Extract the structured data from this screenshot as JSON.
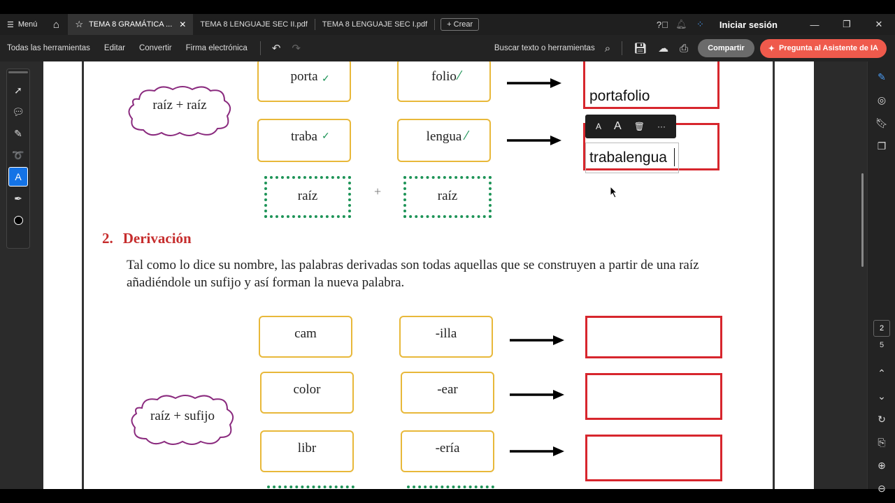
{
  "menu": {
    "label": "Menú"
  },
  "tabs": [
    {
      "label": "TEMA 8 GRAMÁTICA ...",
      "active": true
    },
    {
      "label": "TEMA 8 LENGUAJE SEC II.pdf"
    },
    {
      "label": "TEMA 8 LENGUAJE SEC I.pdf"
    }
  ],
  "create_label": "Crear",
  "signin": "Iniciar sesión",
  "toolbar": {
    "all_tools": "Todas las herramientas",
    "edit": "Editar",
    "convert": "Convertir",
    "esign": "Firma electrónica",
    "search": "Buscar texto o herramientas",
    "share": "Compartir",
    "ai": "Pregunta al Asistente de IA"
  },
  "doc": {
    "composition": {
      "cloud": "raíz + raíz",
      "rows": [
        {
          "a": "porta",
          "b": "folio",
          "answer": "portafolio"
        },
        {
          "a": "traba",
          "b": "lengua",
          "answer": "trabalengua"
        }
      ],
      "blank_a": "raíz",
      "blank_b": "raíz",
      "plus": "+"
    },
    "section": {
      "number": "2.",
      "title": "Derivación"
    },
    "paragraph": "Tal como lo dice su nombre, las palabras derivadas son todas aquellas que se construyen a partir de una raíz añadiéndole un sufijo y así forman la nueva palabra.",
    "derivation": {
      "cloud": "raíz + sufijo",
      "rows": [
        {
          "a": "cam",
          "b": "-illa"
        },
        {
          "a": "color",
          "b": "-ear"
        },
        {
          "a": "libr",
          "b": "-ería"
        }
      ]
    }
  },
  "page_indicator": {
    "current": "2",
    "total": "5"
  },
  "colors": {
    "accent_blue": "#1473e6",
    "ai_button": "#ef5a4c",
    "red_box": "#d7262d",
    "yellow_box": "#e8b83a",
    "green_dotted": "#1e9458",
    "heading_red": "#c62d2d"
  }
}
